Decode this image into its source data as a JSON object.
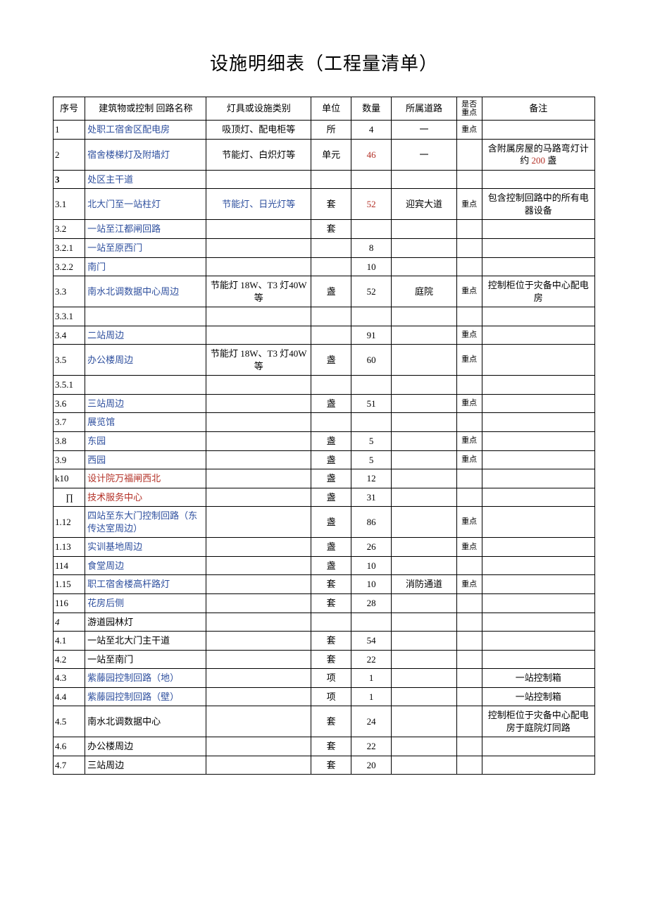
{
  "title": "设施明细表（工程量清单）",
  "headers": {
    "idx": "序号",
    "name": "建筑物或控制\n回路名称",
    "type": "灯具或设施类别",
    "unit": "单位",
    "qty": "数量",
    "road": "所属道路",
    "key": "是否重点",
    "note": "备注"
  },
  "rows": [
    {
      "idx": "1",
      "name": "处职工宿舍区配电房",
      "nameBlue": true,
      "type": "吸顶灯、配电柜等",
      "unit": "所",
      "qty": "4",
      "road": "一",
      "key": "重点",
      "note": ""
    },
    {
      "idx": "2",
      "name": "宿舍楼梯灯及附墙灯",
      "nameBlue": true,
      "type": "节能灯、白炽灯等",
      "unit": "单元",
      "qty": "46",
      "qtyRed": true,
      "road": "一",
      "key": "",
      "note": "含附属房屋的马路弯灯计约 200 盏",
      "noteRedPart": "200"
    },
    {
      "idx": "3",
      "idxBold": true,
      "name": "处区主干道",
      "nameBlue": true,
      "type": "",
      "unit": "",
      "qty": "",
      "road": "",
      "key": "",
      "note": ""
    },
    {
      "idx": "3.1",
      "name": "北大门至一站柱灯",
      "nameBlue": true,
      "type": "节能灯、日光灯等",
      "typeBlue": true,
      "unit": "套",
      "qty": "52",
      "qtyRed": true,
      "road": "迎宾大道",
      "key": "重点",
      "note": "包含控制回路中的所有电器设备"
    },
    {
      "idx": "3.2",
      "name": "一站至江都闸回路",
      "nameBlue": true,
      "type": "",
      "unit": "套",
      "qty": "",
      "road": "",
      "key": "",
      "note": ""
    },
    {
      "idx": "3.2.1",
      "name": "一站至原西门",
      "nameBlue": true,
      "type": "",
      "unit": "",
      "qty": "8",
      "road": "",
      "key": "",
      "note": ""
    },
    {
      "idx": "3.2.2",
      "name": "南门",
      "nameBlue": true,
      "type": "",
      "unit": "",
      "qty": "10",
      "road": "",
      "key": "",
      "note": ""
    },
    {
      "idx": "3.3",
      "name": "南水北调数据中心周边",
      "nameBlue": true,
      "type": "节能灯 18W、T3 灯40W 等",
      "unit": "盏",
      "qty": "52",
      "road": "庭院",
      "key": "重点",
      "note": "控制柜位于灾备中心配电房"
    },
    {
      "idx": "3.3.1",
      "name": "",
      "type": "",
      "unit": "",
      "qty": "",
      "road": "",
      "key": "",
      "note": ""
    },
    {
      "idx": "3.4",
      "name": "二站周边",
      "nameBlue": true,
      "type": "",
      "unit": "",
      "qty": "91",
      "road": "",
      "key": "重点",
      "note": ""
    },
    {
      "idx": "3.5",
      "name": "办公楼周边",
      "nameBlue": true,
      "type": "节能灯 18W、T3 灯40W 等",
      "unit": "盏",
      "qty": "60",
      "road": "",
      "key": "重点",
      "note": ""
    },
    {
      "idx": "3.5.1",
      "name": "",
      "type": "",
      "unit": "",
      "qty": "",
      "road": "",
      "key": "",
      "note": ""
    },
    {
      "idx": "3.6",
      "name": "三站周边",
      "nameBlue": true,
      "type": "",
      "unit": "盏",
      "qty": "51",
      "road": "",
      "key": "重点",
      "note": ""
    },
    {
      "idx": "3.7",
      "name": "展览馆",
      "nameBlue": true,
      "type": "",
      "unit": "",
      "qty": "",
      "road": "",
      "key": "",
      "note": ""
    },
    {
      "idx": "3.8",
      "name": "东园",
      "nameBlue": true,
      "type": "",
      "unit": "盏",
      "qty": "5",
      "road": "",
      "key": "重点",
      "note": ""
    },
    {
      "idx": "3.9",
      "name": "西园",
      "nameBlue": true,
      "type": "",
      "unit": "盏",
      "qty": "5",
      "road": "",
      "key": "重点",
      "note": ""
    },
    {
      "idx": "k10",
      "name": "设计院万福闸西北",
      "nameRed": true,
      "type": "",
      "unit": "盏",
      "qty": "12",
      "road": "",
      "key": "",
      "note": ""
    },
    {
      "idx": "∏",
      "idxCenter": true,
      "name": "技术服务中心",
      "nameRed": true,
      "type": "",
      "unit": "盏",
      "qty": "31",
      "road": "",
      "key": "",
      "note": ""
    },
    {
      "idx": "1.12",
      "name": "四站至东大门控制回路（东传达室周边）",
      "nameBlue": true,
      "type": "",
      "unit": "盏",
      "qty": "86",
      "road": "",
      "key": "重点",
      "note": ""
    },
    {
      "idx": "1.13",
      "name": "实训基地周边",
      "nameBlue": true,
      "type": "",
      "unit": "盏",
      "qty": "26",
      "road": "",
      "key": "重点",
      "note": ""
    },
    {
      "idx": "114",
      "name": "食堂周边",
      "nameBlue": true,
      "type": "",
      "unit": "盏",
      "qty": "10",
      "road": "",
      "key": "",
      "note": ""
    },
    {
      "idx": "1.15",
      "name": "职工宿舍楼高杆路灯",
      "nameBlue": true,
      "type": "",
      "unit": "套",
      "qty": "10",
      "road": "消防通道",
      "key": "重点",
      "note": ""
    },
    {
      "idx": "116",
      "name": "花房后侧",
      "nameBlue": true,
      "type": "",
      "unit": "套",
      "qty": "28",
      "road": "",
      "key": "",
      "note": ""
    },
    {
      "idx": "4",
      "idxItalic": true,
      "name": "游道园林灯",
      "type": "",
      "unit": "",
      "qty": "",
      "road": "",
      "key": "",
      "note": ""
    },
    {
      "idx": "4.1",
      "name": "一站至北大门主干道",
      "type": "",
      "unit": "套",
      "qty": "54",
      "road": "",
      "key": "",
      "note": ""
    },
    {
      "idx": "4.2",
      "name": "一站至南门",
      "type": "",
      "unit": "套",
      "qty": "22",
      "road": "",
      "key": "",
      "note": ""
    },
    {
      "idx": "4.3",
      "name": "紫藤园控制回路（地）",
      "nameBlue": true,
      "type": "",
      "unit": "项",
      "qty": "1",
      "road": "",
      "key": "",
      "note": "一站控制箱"
    },
    {
      "idx": "4.4",
      "name": "紫藤园控制回路（壁）",
      "nameBlue": true,
      "type": "",
      "unit": "项",
      "qty": "1",
      "road": "",
      "key": "",
      "note": "一站控制箱"
    },
    {
      "idx": "4.5",
      "name": "南水北调数据中心",
      "type": "",
      "unit": "套",
      "qty": "24",
      "road": "",
      "key": "",
      "note": "控制柜位于灾备中心配电房于庭院灯同路"
    },
    {
      "idx": "4.6",
      "name": "办公楼周边",
      "type": "",
      "unit": "套",
      "qty": "22",
      "road": "",
      "key": "",
      "note": ""
    },
    {
      "idx": "4.7",
      "name": "三站周边",
      "type": "",
      "unit": "套",
      "qty": "20",
      "road": "",
      "key": "",
      "note": ""
    }
  ]
}
